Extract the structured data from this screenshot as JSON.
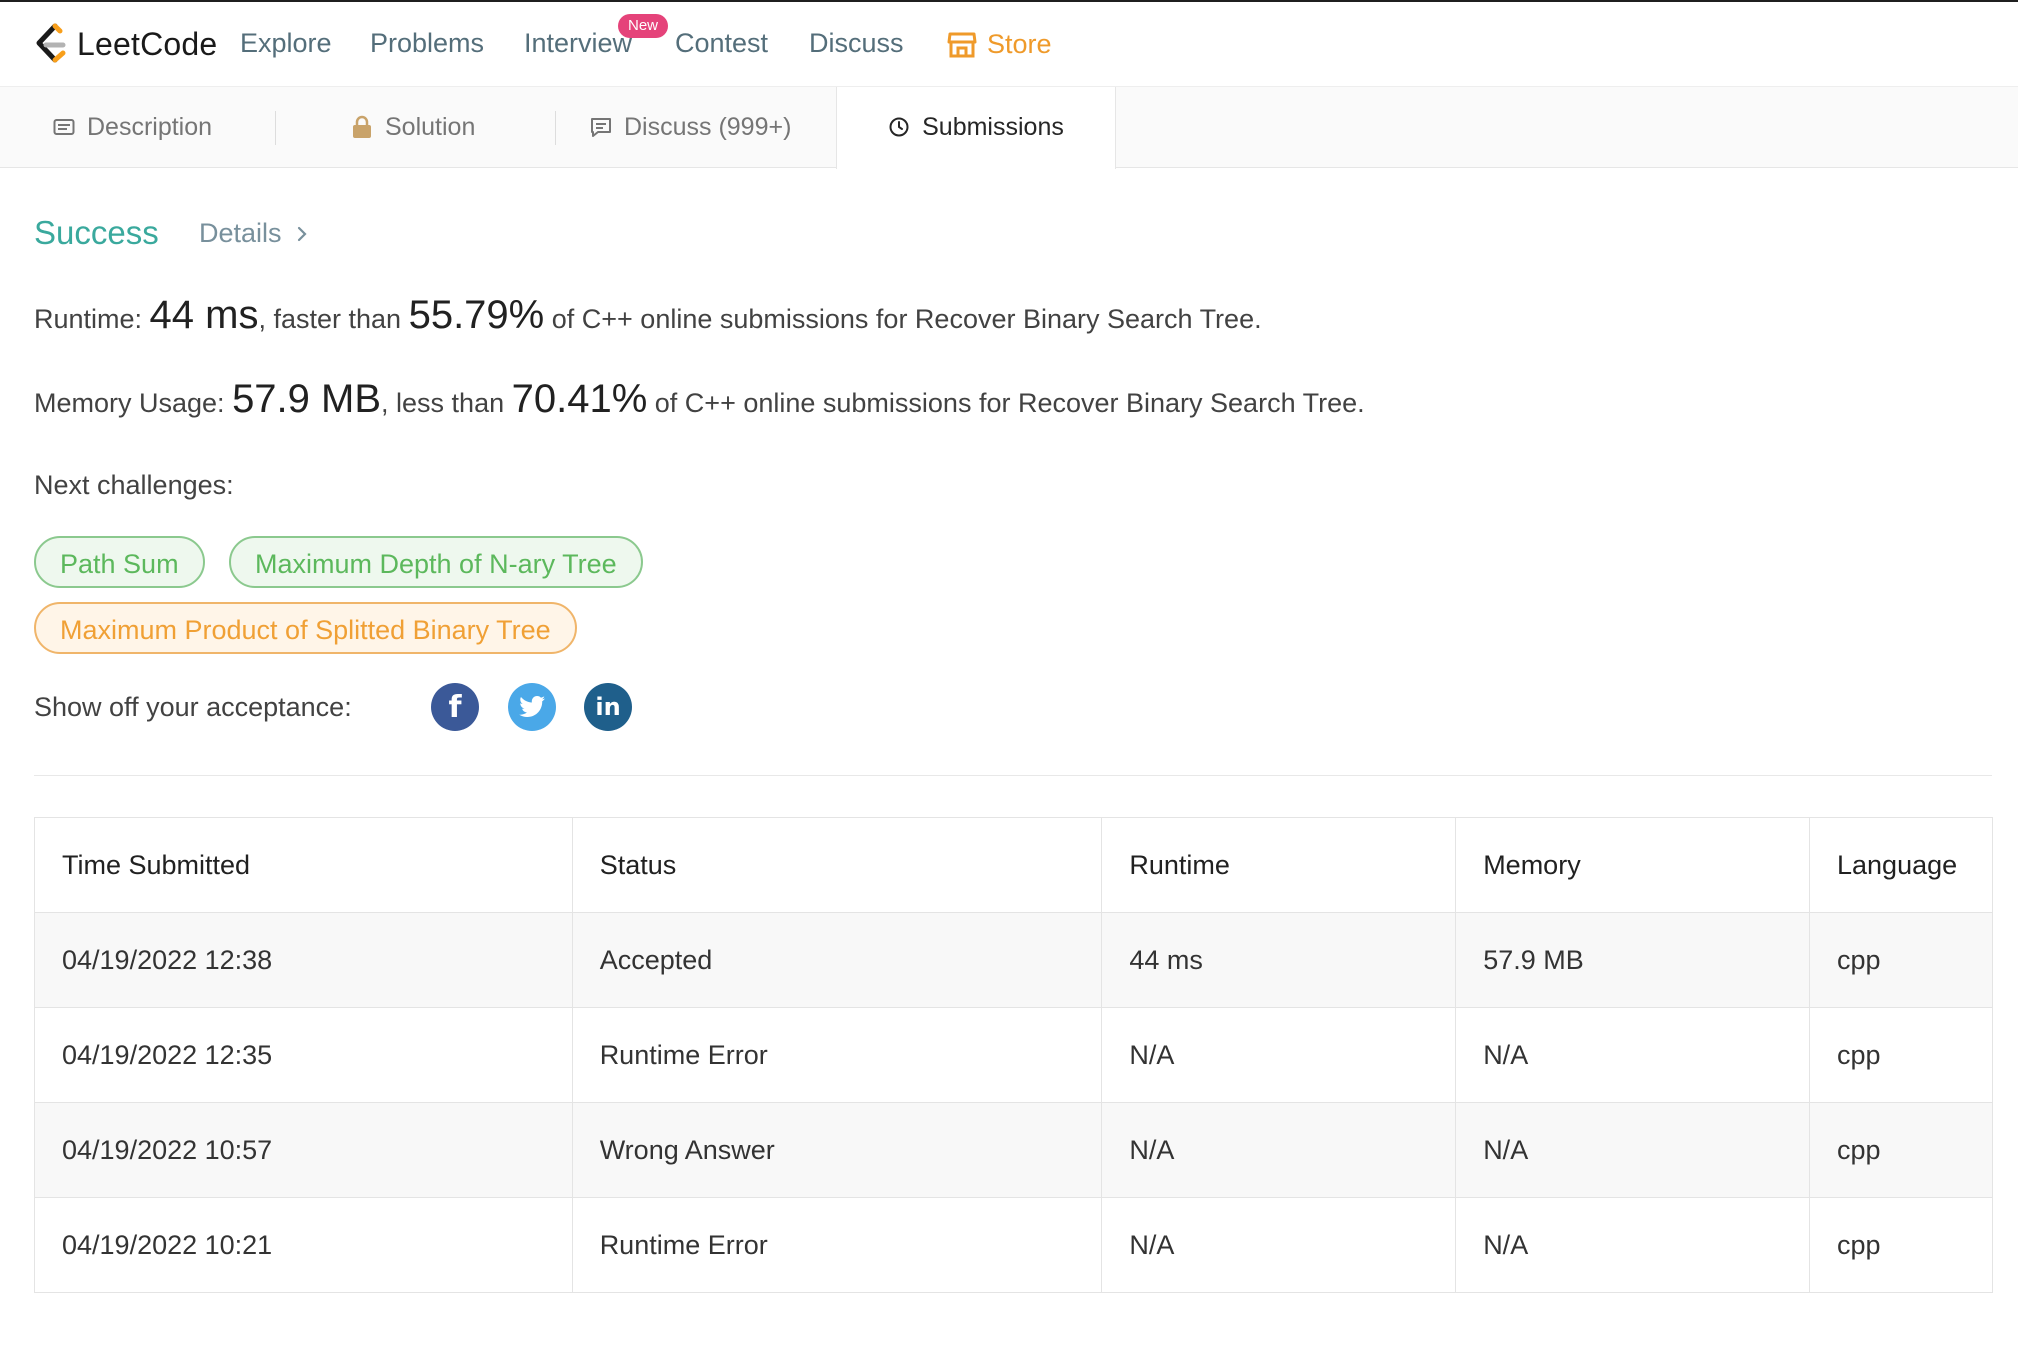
{
  "nav": {
    "logo_text": "LeetCode",
    "items": [
      "Explore",
      "Problems",
      "Interview",
      "Contest",
      "Discuss"
    ],
    "new_badge": "New",
    "store": "Store",
    "store_color": "#ef9a2a"
  },
  "tabs": [
    {
      "label": "Description",
      "icon": "description-icon"
    },
    {
      "label": "Solution",
      "icon": "lock-icon"
    },
    {
      "label": "Discuss (999+)",
      "icon": "comment-icon"
    },
    {
      "label": "Submissions",
      "icon": "clock-icon",
      "active": true
    }
  ],
  "result": {
    "status": "Success",
    "status_color": "#3aa99d",
    "details": "Details",
    "runtime": {
      "label": "Runtime: ",
      "value": "44 ms",
      "mid": ", faster than ",
      "percent": "55.79%",
      "suffix": " of C++ online submissions for Recover Binary Search Tree."
    },
    "memory": {
      "label": "Memory Usage: ",
      "value": "57.9 MB",
      "mid": ", less than ",
      "percent": "70.41%",
      "suffix": " of C++ online submissions for Recover Binary Search Tree."
    }
  },
  "next": {
    "label": "Next challenges:",
    "challenges": [
      {
        "title": "Path Sum",
        "difficulty": "easy"
      },
      {
        "title": "Maximum Depth of N-ary Tree",
        "difficulty": "easy"
      },
      {
        "title": "Maximum Product of Splitted Binary Tree",
        "difficulty": "medium"
      }
    ]
  },
  "share": {
    "label": "Show off your acceptance:",
    "networks": [
      "facebook-icon",
      "twitter-icon",
      "linkedin-icon"
    ]
  },
  "table": {
    "headers": [
      "Time Submitted",
      "Status",
      "Runtime",
      "Memory",
      "Language"
    ],
    "rows": [
      {
        "time": "04/19/2022 12:38",
        "status": "Accepted",
        "runtime": "44 ms",
        "memory": "57.9 MB",
        "language": "cpp"
      },
      {
        "time": "04/19/2022 12:35",
        "status": "Runtime Error",
        "runtime": "N/A",
        "memory": "N/A",
        "language": "cpp"
      },
      {
        "time": "04/19/2022 10:57",
        "status": "Wrong Answer",
        "runtime": "N/A",
        "memory": "N/A",
        "language": "cpp"
      },
      {
        "time": "04/19/2022 10:21",
        "status": "Runtime Error",
        "runtime": "N/A",
        "memory": "N/A",
        "language": "cpp"
      }
    ]
  }
}
